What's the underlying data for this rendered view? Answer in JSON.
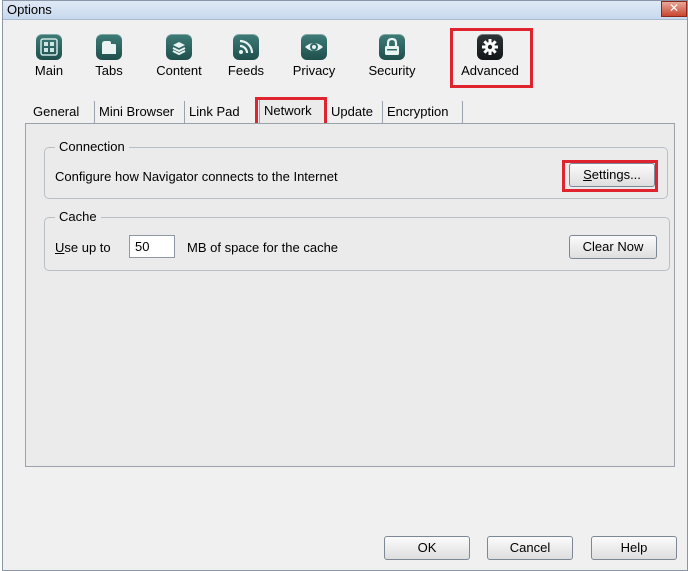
{
  "window": {
    "title": "Options"
  },
  "toolbar": {
    "items": [
      {
        "label": "Main",
        "icon": "main-icon"
      },
      {
        "label": "Tabs",
        "icon": "tabs-icon"
      },
      {
        "label": "Content",
        "icon": "content-icon"
      },
      {
        "label": "Feeds",
        "icon": "feeds-icon"
      },
      {
        "label": "Privacy",
        "icon": "privacy-icon"
      },
      {
        "label": "Security",
        "icon": "security-icon"
      },
      {
        "label": "Advanced",
        "icon": "advanced-gear-icon"
      }
    ],
    "selected": "Advanced"
  },
  "tabs": [
    "General",
    "Mini Browser",
    "Link Pad",
    "Network",
    "Update",
    "Encryption"
  ],
  "active_tab": "Network",
  "connection": {
    "legend": "Connection",
    "description": "Configure how Navigator connects to the Internet",
    "settings_button": {
      "accel": "S",
      "rest": "ettings..."
    }
  },
  "cache": {
    "legend": "Cache",
    "use_up_to_accel": "U",
    "use_up_to_rest": "se up to",
    "value": "50",
    "suffix": "MB of space for the cache",
    "clear_button": "Clear Now"
  },
  "footer": {
    "ok": "OK",
    "cancel": "Cancel",
    "help": "Help"
  },
  "colors": {
    "highlight": "#e0242f",
    "icon_bg": "#2f6a66"
  }
}
